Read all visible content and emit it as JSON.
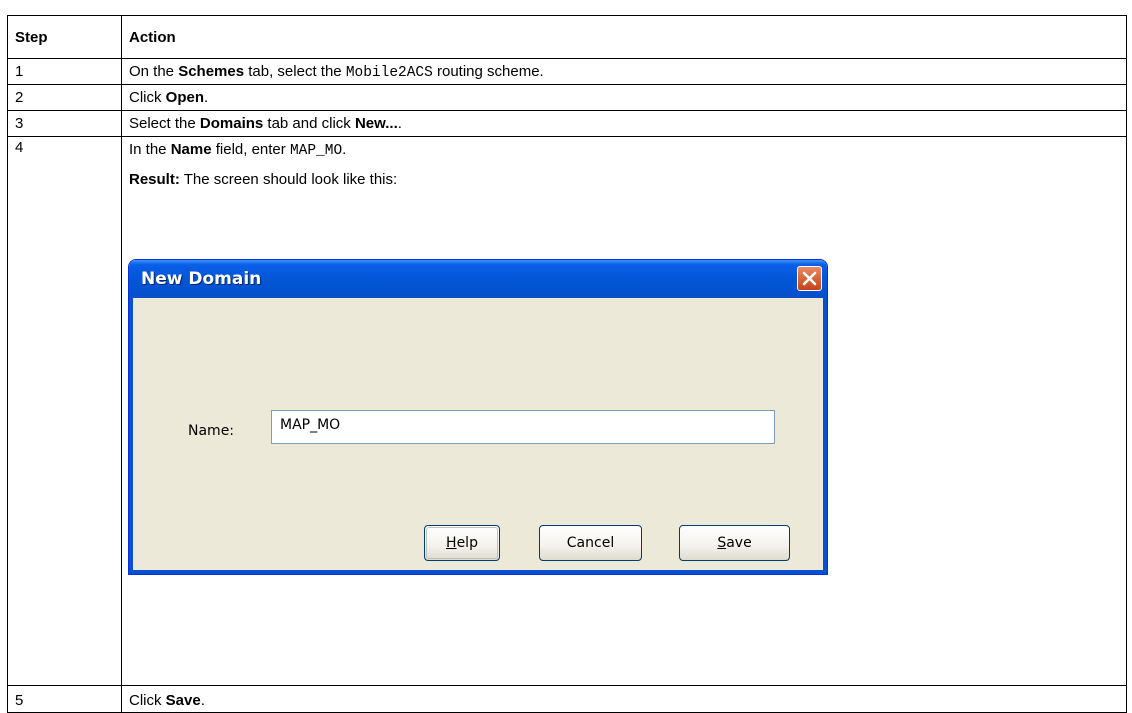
{
  "table": {
    "headers": [
      "Step",
      "Action"
    ],
    "rows": [
      {
        "step": "1",
        "pre": "On the ",
        "b1": "Schemes",
        "mid": " tab, select the ",
        "code": "Mobile2ACS",
        "post": " routing scheme."
      },
      {
        "step": "2",
        "pre": "Click ",
        "b1": "Open",
        "post": "."
      },
      {
        "step": "3",
        "pre": "Select the ",
        "b1": "Domains",
        "mid": " tab and click ",
        "b2": "New...",
        "post": "."
      },
      {
        "step": "4",
        "pre": "In the ",
        "b1": "Name",
        "mid": " field, enter ",
        "code": "MAP_MO",
        "post": ".",
        "result_label": "Result:",
        "result_text": " The screen should look like this:"
      },
      {
        "step": "5",
        "pre": "Click ",
        "b1": "Save",
        "post": "."
      }
    ]
  },
  "dialog": {
    "title": "New Domain",
    "name_label": "Name:",
    "name_value": "MAP_MO",
    "buttons": {
      "help": "Help",
      "cancel": "Cancel",
      "save": "Save"
    },
    "icons": {
      "close": "close-icon"
    }
  }
}
